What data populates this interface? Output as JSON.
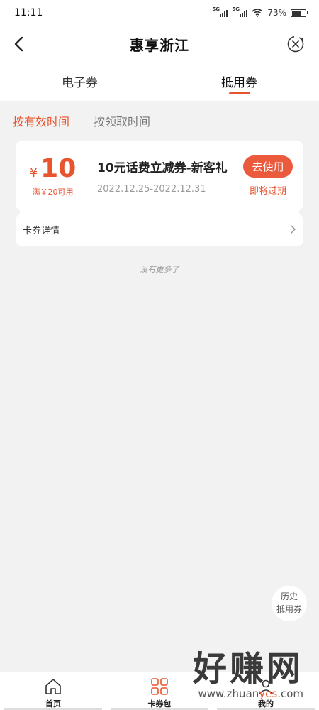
{
  "status_bar": {
    "time": "11:11",
    "signal1": "5G",
    "signal2": "5G",
    "battery": "73%",
    "battery_level": 0.73
  },
  "header": {
    "title": "惠享浙江"
  },
  "tabs": [
    {
      "label": "电子券",
      "active": false
    },
    {
      "label": "抵用券",
      "active": true
    }
  ],
  "filters": [
    {
      "label": "按有效时间",
      "active": true
    },
    {
      "label": "按领取时间",
      "active": false
    }
  ],
  "coupon": {
    "currency": "¥",
    "amount": "10",
    "condition": "满￥20可用",
    "title": "10元话费立减券-新客礼",
    "date_range": "2022.12.25-2022.12.31",
    "action_label": "去使用",
    "status": "即将过期",
    "details_label": "卡券详情"
  },
  "no_more": "没有更多了",
  "history": {
    "line1": "历史",
    "line2": "抵用券"
  },
  "bottom_nav": [
    {
      "label": "首页"
    },
    {
      "label": "卡券包"
    },
    {
      "label": "我的"
    }
  ],
  "watermark": {
    "text": "好赚网",
    "url_prefix": "www.zhuan",
    "url_accent": "yes",
    "url_suffix": ".com"
  },
  "colors": {
    "accent": "#e8542e",
    "button": "#eb5a3c",
    "background": "#f2f2f2"
  }
}
